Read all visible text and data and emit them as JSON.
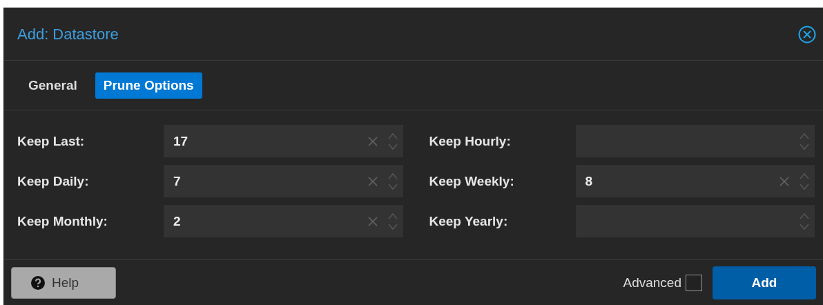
{
  "window": {
    "title": "Add: Datastore"
  },
  "tabs": [
    {
      "label": "General",
      "selected": false
    },
    {
      "label": "Prune Options",
      "selected": true
    }
  ],
  "fields": [
    {
      "label": "Keep Last:",
      "value": "17"
    },
    {
      "label": "Keep Hourly:"
    },
    {
      "label": "Keep Daily:",
      "value": "7"
    },
    {
      "label": "Keep Weekly:",
      "value": "8"
    },
    {
      "label": "Keep Monthly:",
      "value": "2"
    },
    {
      "label": "Keep Yearly:"
    }
  ],
  "footer": {
    "help": "Help",
    "advanced": {
      "label": "Advanced",
      "checked": false
    },
    "submit": "Add"
  }
}
